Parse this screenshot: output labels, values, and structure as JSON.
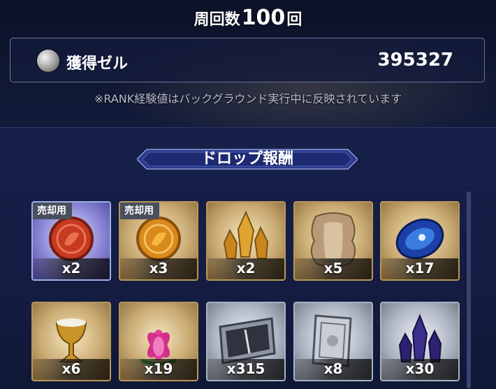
{
  "header": {
    "runs_prefix": "周回数",
    "runs_count": "100",
    "runs_suffix": "回"
  },
  "currency": {
    "icon": "zell-coin-icon",
    "label": "獲得ゼル",
    "value": "395327"
  },
  "notice": "※RANK経験値はバックグラウンド実行中に反映されています",
  "drops": {
    "title": "ドロップ報酬",
    "items": [
      {
        "icon": "red-coin-icon",
        "tag": "売却用",
        "qty": "x2",
        "frame": "purple"
      },
      {
        "icon": "gold-coin-icon",
        "tag": "売却用",
        "qty": "x3",
        "frame": "gold"
      },
      {
        "icon": "amber-crystal-icon",
        "tag": "",
        "qty": "x2",
        "frame": "gold"
      },
      {
        "icon": "beast-hide-icon",
        "tag": "",
        "qty": "x5",
        "frame": "gold"
      },
      {
        "icon": "blue-gem-icon",
        "tag": "",
        "qty": "x17",
        "frame": "gold"
      },
      {
        "icon": "golden-chalice-icon",
        "tag": "",
        "qty": "x6",
        "frame": "gold"
      },
      {
        "icon": "pink-lotus-icon",
        "tag": "",
        "qty": "x19",
        "frame": "gold"
      },
      {
        "icon": "silver-ticket-icon",
        "tag": "",
        "qty": "x315",
        "frame": "silver"
      },
      {
        "icon": "silver-tome-icon",
        "tag": "",
        "qty": "x8",
        "frame": "silver"
      },
      {
        "icon": "dark-crystal-icon",
        "tag": "",
        "qty": "x30",
        "frame": "silver"
      }
    ]
  }
}
